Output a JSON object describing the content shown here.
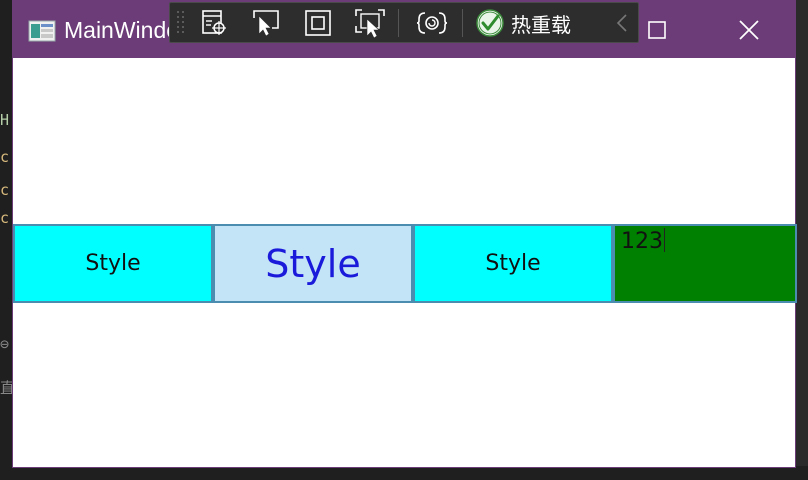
{
  "window": {
    "title": "MainWindow",
    "title_bar_color": "#6b3c77"
  },
  "toolbar": {
    "hot_reload_label": "热重载",
    "icons": [
      "select-element-icon",
      "select-pointer-icon",
      "display-layout-adorner-icon",
      "track-focus-icon",
      "hot-reload-settings-icon",
      "hot-reload-status-icon",
      "collapse-chevron-icon"
    ]
  },
  "content": {
    "buttons": [
      {
        "label": "Style",
        "background": "#00ffff",
        "foreground": "#111111"
      },
      {
        "label": "Style",
        "background": "#c3e3f7",
        "foreground": "#1a1adb"
      },
      {
        "label": "Style",
        "background": "#00ffff",
        "foreground": "#111111"
      }
    ],
    "textbox": {
      "value": "123",
      "background": "#008000"
    }
  }
}
